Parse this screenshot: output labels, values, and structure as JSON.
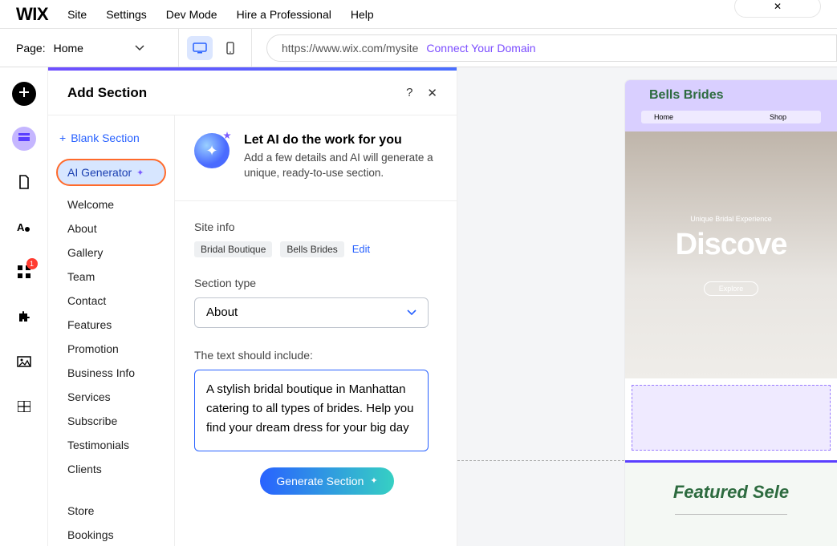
{
  "topnav": {
    "logo": "WIX",
    "items": [
      "Site",
      "Settings",
      "Dev Mode",
      "Hire a Professional",
      "Help"
    ],
    "pill_x": "✕"
  },
  "secondbar": {
    "page_label": "Page:",
    "page_value": "Home",
    "url": "https://www.wix.com/mysite",
    "connect": "Connect Your Domain"
  },
  "rail": {
    "apps_badge": "1"
  },
  "panel": {
    "title": "Add Section",
    "help": "?",
    "close": "✕",
    "blank": "Blank Section",
    "ai_item": "AI Generator",
    "nav": [
      "Welcome",
      "About",
      "Gallery",
      "Team",
      "Contact",
      "Features",
      "Promotion",
      "Business Info",
      "Services",
      "Subscribe",
      "Testimonials",
      "Clients"
    ],
    "nav2": [
      "Store",
      "Bookings"
    ],
    "hero_title": "Let AI do the work for you",
    "hero_body": "Add a few details and AI will generate a unique, ready-to-use section.",
    "site_info_label": "Site info",
    "chip1": "Bridal Boutique",
    "chip2": "Bells Brides",
    "edit": "Edit",
    "section_type_label": "Section type",
    "section_type_value": "About",
    "include_label": "The text should include:",
    "include_value": "A stylish bridal boutique in Manhattan catering to all types of brides. Help you find your dream dress for your big day",
    "generate": "Generate Section"
  },
  "preview": {
    "brand": "Bells Brides",
    "nav_home": "Home",
    "nav_shop": "Shop",
    "hero_sub": "Unique Bridal Experience",
    "hero_title": "Discove",
    "hero_btn": "Explore",
    "featured": "Featured Sele"
  }
}
